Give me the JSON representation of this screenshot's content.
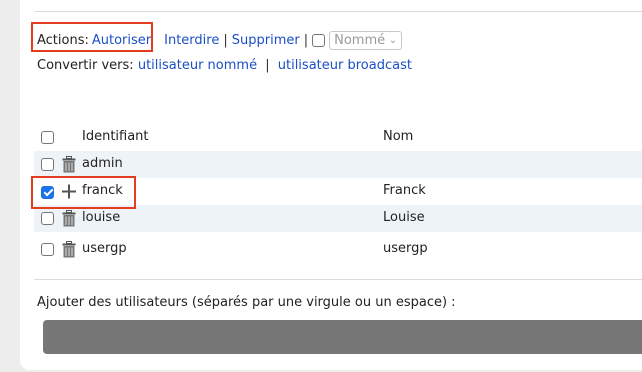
{
  "actions": {
    "label": "Actions:",
    "items": [
      "Autoriser",
      "Interdire",
      "Supprimer"
    ],
    "separator": "|",
    "select_value": "Nommé"
  },
  "convert": {
    "label": "Convertir vers:",
    "links": [
      "utilisateur nommé",
      "utilisateur broadcast"
    ],
    "separator": "|"
  },
  "table": {
    "headers": {
      "id": "Identifiant",
      "nom": "Nom"
    },
    "rows": [
      {
        "id": "admin",
        "nom": "",
        "icon": "trash-icon",
        "checked": false
      },
      {
        "id": "franck",
        "nom": "Franck",
        "icon": "plus-icon",
        "checked": true
      },
      {
        "id": "louise",
        "nom": "Louise",
        "icon": "trash-icon",
        "checked": false
      },
      {
        "id": "usergp",
        "nom": "usergp",
        "icon": "trash-icon",
        "checked": false
      }
    ]
  },
  "add_users": {
    "label": "Ajouter des utilisateurs (séparés par une virgule ou un espace) :",
    "value": ""
  },
  "colors": {
    "link": "#1b4fc6",
    "highlight_box": "#e53b1f",
    "row_alt": "#eef3f8",
    "checkbox_checked": "#1a73e8"
  }
}
